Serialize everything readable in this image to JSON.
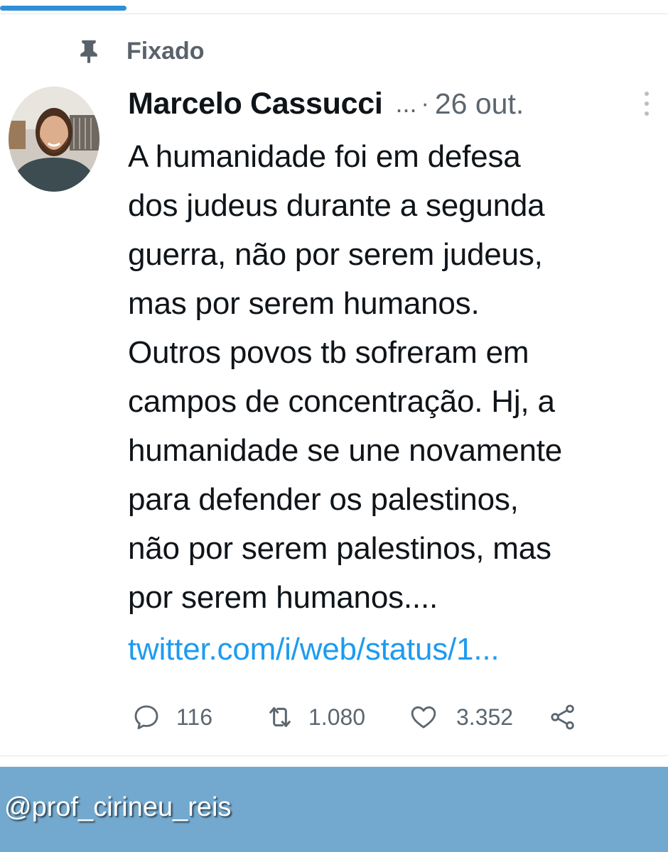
{
  "pinned": {
    "label": "Fixado",
    "icon": "pin-icon"
  },
  "tweet": {
    "author_name": "Marcelo Cassucci",
    "author_handle": "...",
    "separator": "·",
    "timestamp": "26 out.",
    "text_lines": [
      "A humanidade foi em defesa",
      "dos judeus durante a segunda",
      "guerra, não por serem judeus,",
      "mas por serem humanos.",
      "Outros povos tb sofreram em",
      "campos de concentração. Hj, a",
      "humanidade se une novamente",
      "para defender os palestinos,",
      "não por serem palestinos, mas",
      "por serem humanos...."
    ],
    "link": "twitter.com/i/web/status/1..."
  },
  "actions": {
    "replies": {
      "icon": "reply-icon",
      "count": "116"
    },
    "retweets": {
      "icon": "retweet-icon",
      "count": "1.080"
    },
    "likes": {
      "icon": "heart-icon",
      "count": "3.352"
    },
    "share": {
      "icon": "share-icon"
    }
  },
  "watermark": "@prof_cirineu_reis",
  "colors": {
    "accent": "#2f8fd8",
    "link": "#1d9bf0",
    "footer": "#73a9cf",
    "text": "#0f1419",
    "muted": "#5b6670"
  }
}
